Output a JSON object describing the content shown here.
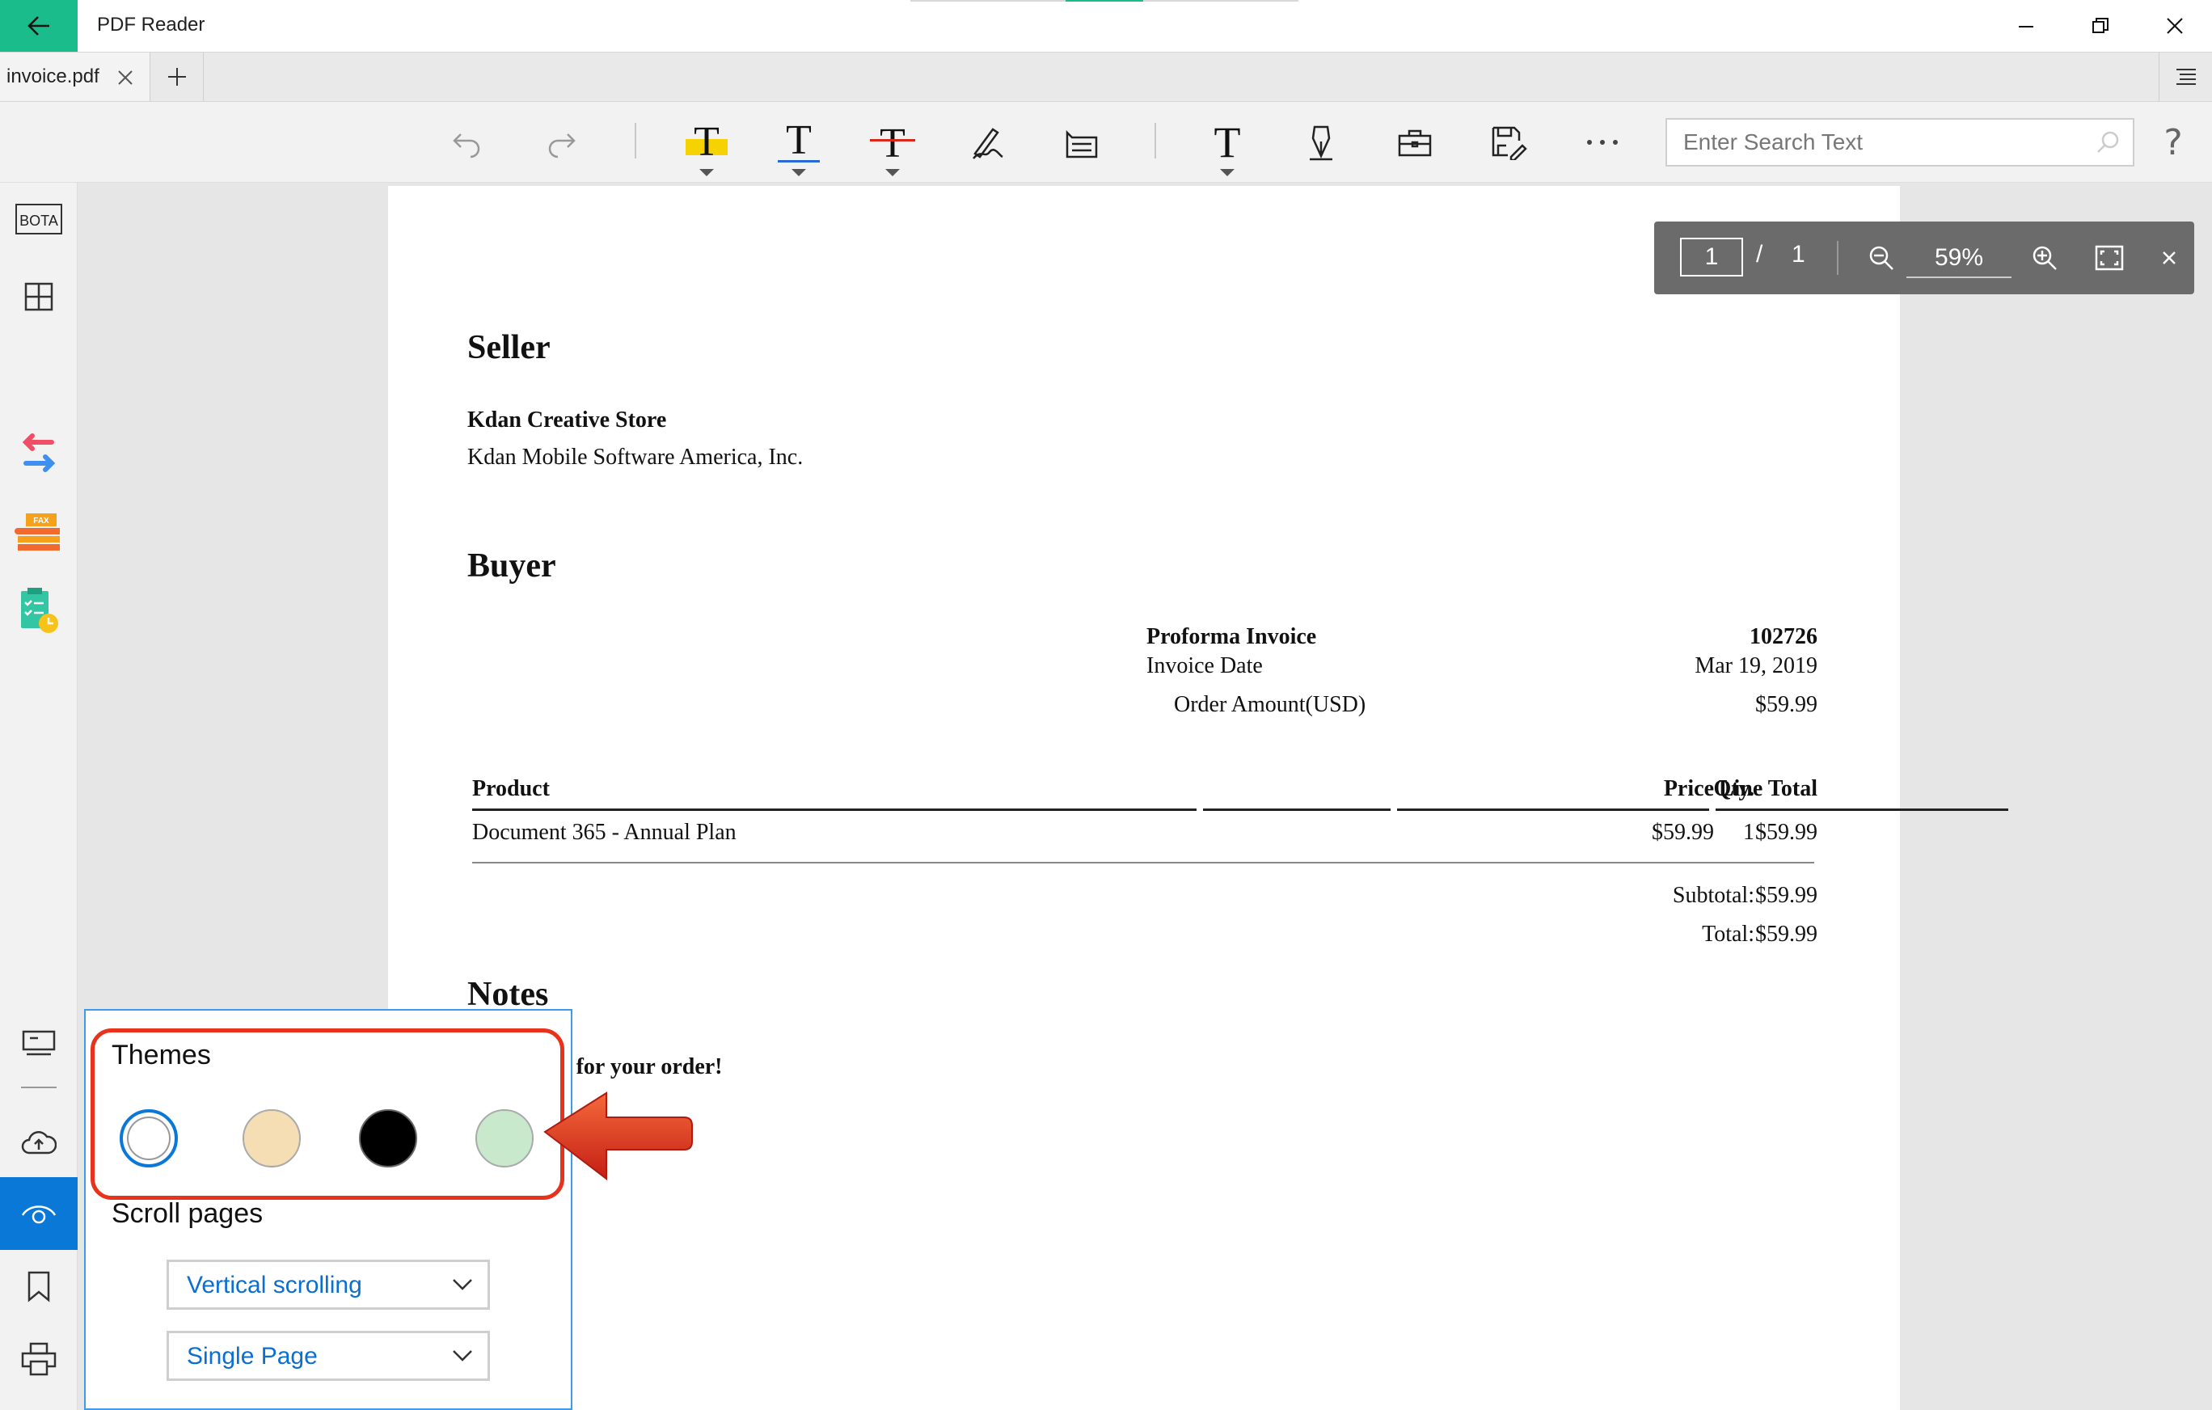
{
  "titlebar": {
    "app_title": "PDF Reader"
  },
  "tabs": [
    {
      "label": "invoice.pdf"
    }
  ],
  "search": {
    "placeholder": "Enter Search Text"
  },
  "help": {
    "label": "?"
  },
  "zoombar": {
    "page_current": "1",
    "page_separator": "/",
    "page_total": "1",
    "zoom_value": "59%"
  },
  "document": {
    "seller_heading": "Seller",
    "seller_name": "Kdan Creative Store",
    "seller_company": "Kdan Mobile Software America, Inc.",
    "buyer_heading": "Buyer",
    "proforma_label": "Proforma Invoice",
    "proforma_value": "102726",
    "invoice_date_label": "Invoice Date",
    "invoice_date_value": "Mar 19, 2019",
    "order_amount_label": "Order Amount(USD)",
    "order_amount_value": "$59.99",
    "table": {
      "headers": [
        "Product",
        "Price",
        "Qty.",
        "Line Total"
      ],
      "rows": [
        [
          "Document 365 - Annual Plan",
          "$59.99",
          "1",
          "$59.99"
        ]
      ]
    },
    "subtotal_label": "Subtotal:",
    "subtotal_value": "$59.99",
    "total_label": "Total:",
    "total_value": "$59.99",
    "notes_heading": "Notes",
    "notes_text": "n for your order!"
  },
  "view_settings": {
    "themes_label": "Themes",
    "themes": [
      {
        "name": "white",
        "color": "#ffffff",
        "selected": true
      },
      {
        "name": "sepia",
        "color": "#f5deb3",
        "selected": false
      },
      {
        "name": "black",
        "color": "#000000",
        "selected": false
      },
      {
        "name": "green",
        "color": "#c9e9cd",
        "selected": false
      }
    ],
    "scroll_label": "Scroll pages",
    "scroll_mode": "Vertical scrolling",
    "page_mode": "Single Page"
  },
  "colors": {
    "accent": "#1abc8c",
    "active_sidebar": "#0a78d7",
    "highlight": "#e8321c",
    "flyout_border": "#3d9be9"
  },
  "sidebar": {
    "bota_label": "BOTA",
    "fax_label": "FAX"
  }
}
